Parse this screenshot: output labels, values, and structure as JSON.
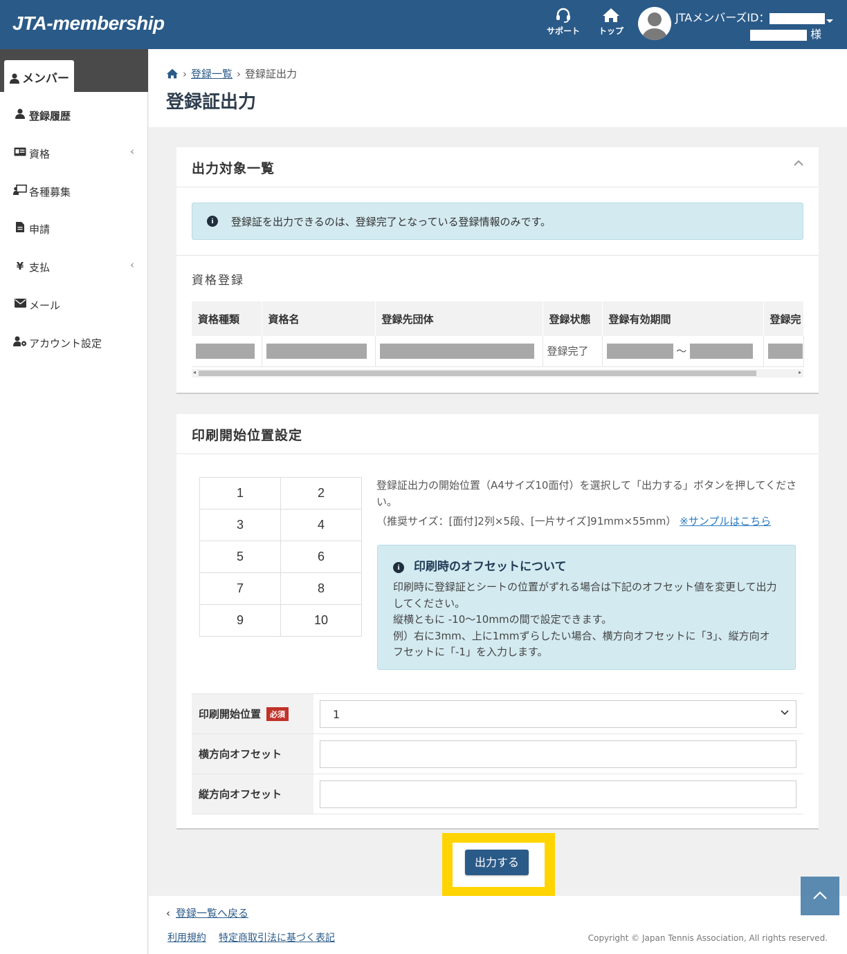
{
  "header": {
    "logo": "JTA-membership",
    "support_label": "サポート",
    "top_label": "トップ",
    "member_id_label": "JTAメンバーズID：",
    "honorific": "様"
  },
  "sidebar": {
    "tab_label": "メンバー",
    "items": [
      {
        "label": "登録履歴",
        "icon": "user-icon",
        "active": true
      },
      {
        "label": "資格",
        "icon": "id-card-icon",
        "has_submenu": true
      },
      {
        "label": "各種募集",
        "icon": "presentation-icon"
      },
      {
        "label": "申請",
        "icon": "file-icon"
      },
      {
        "label": "支払",
        "icon": "yen-icon",
        "has_submenu": true
      },
      {
        "label": "メール",
        "icon": "envelope-icon"
      },
      {
        "label": "アカウント設定",
        "icon": "user-gear-icon"
      }
    ]
  },
  "breadcrumb": {
    "link": "登録一覧",
    "current": "登録証出力"
  },
  "page_title": "登録証出力",
  "target_card": {
    "title": "出力対象一覧",
    "info": "登録証を出力できるのは、登録完了となっている登録情報のみです。",
    "section_label": "資格登録",
    "columns": [
      "資格種類",
      "資格名",
      "登録先団体",
      "登録状態",
      "登録有効期間",
      "登録完"
    ],
    "row": {
      "status": "登録完了",
      "period_sep": "～"
    }
  },
  "print_card": {
    "title": "印刷開始位置設定",
    "grid": [
      [
        "1",
        "2"
      ],
      [
        "3",
        "4"
      ],
      [
        "5",
        "6"
      ],
      [
        "7",
        "8"
      ],
      [
        "9",
        "10"
      ]
    ],
    "desc_line1": "登録証出力の開始位置（A4サイズ10面付）を選択して「出力する」ボタンを押してください。",
    "desc_line2": "（推奨サイズ：[面付]2列×5段、[一片サイズ]91mm×55mm）",
    "sample_link": "※サンプルはこちら",
    "offset_title": "印刷時のオフセットについて",
    "offset_text1": "印刷時に登録証とシートの位置がずれる場合は下記のオフセット値を変更して出力してください。",
    "offset_text2": "縦横ともに -10～10mmの間で設定できます。",
    "offset_text3": "例）右に3mm、上に1mmずらしたい場合、横方向オフセットに「3」、縦方向オフセットに「-1」を入力します。",
    "form": {
      "start_label": "印刷開始位置",
      "required": "必須",
      "start_value": "1",
      "h_offset_label": "横方向オフセット",
      "h_offset_value": "",
      "v_offset_label": "縦方向オフセット",
      "v_offset_value": ""
    }
  },
  "output_button": "出力する",
  "footer": {
    "back_link": "登録一覧へ戻る",
    "links": [
      "利用規約",
      "特定商取引法に基づく表記"
    ],
    "copyright": "Copyright © Japan Tennis Association, All rights reserved."
  }
}
